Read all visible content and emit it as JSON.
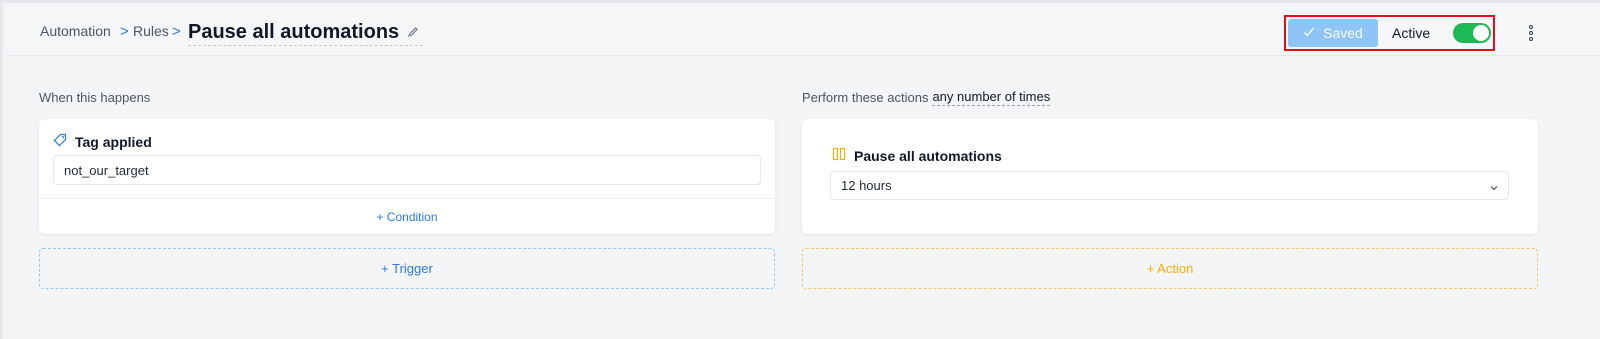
{
  "breadcrumb": {
    "items": [
      "Automation",
      "Rules"
    ],
    "separator": ">",
    "title": "Pause all automations"
  },
  "status": {
    "saved_label": "Saved",
    "active_label": "Active",
    "active_on": true
  },
  "colors": {
    "accent": "#2b7bd9",
    "saved_bg": "#8ec4f6",
    "toggle_on": "#1db954",
    "action_accent": "#f5b100",
    "highlight": "#e3101b"
  },
  "trigger_section": {
    "label": "When this happens",
    "card_title": "Tag applied",
    "tag_value": "not_our_target",
    "add_condition_label": "+ Condition",
    "add_trigger_label": "+ Trigger"
  },
  "action_section": {
    "label_prefix": "Perform these actions",
    "times_link": "any number of times",
    "card_title": "Pause all automations",
    "duration_value": "12 hours",
    "add_action_label": "+ Action"
  }
}
